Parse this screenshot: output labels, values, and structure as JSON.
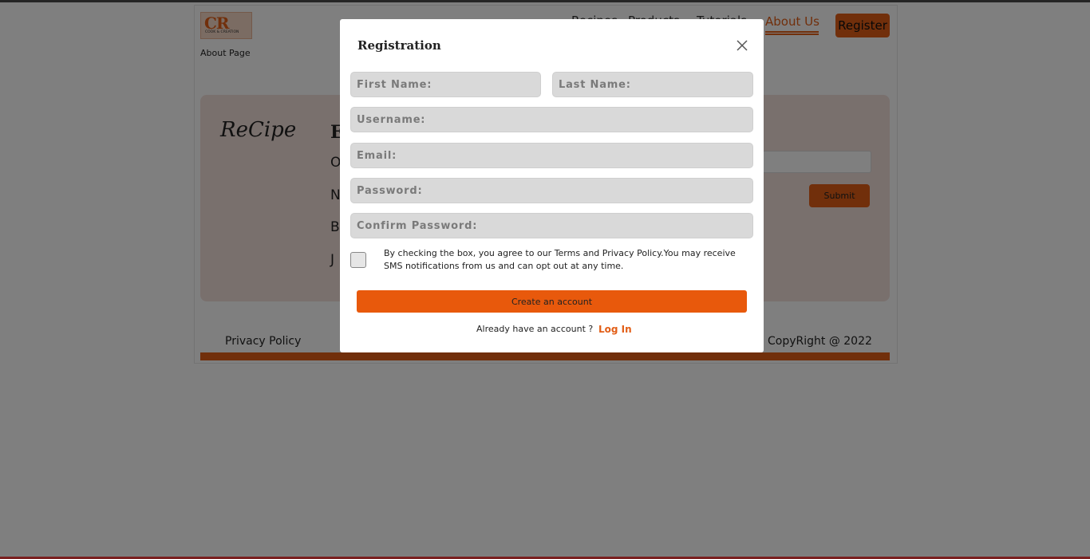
{
  "header": {
    "logo_text": "CR",
    "logo_subtext": "COOK & CREATION",
    "page_subtitle": "About Page",
    "nav": [
      "Recipes",
      "Products",
      "Tutorials",
      "About Us"
    ],
    "register_label": "Register"
  },
  "background_panel": {
    "brand_script": "ReCipe",
    "heading_fragment": "E",
    "line_fragments": [
      "O",
      "N",
      "B",
      "J"
    ],
    "submit_label": "Submit"
  },
  "footer": {
    "privacy_label": "Privacy Policy",
    "copyright_label": "CopyRight @ 2022"
  },
  "modal": {
    "title": "Registration",
    "first_name_placeholder": "First Name:",
    "last_name_placeholder": "Last Name:",
    "username_placeholder": "Username:",
    "email_placeholder": "Email:",
    "password_placeholder": "Password:",
    "confirm_password_placeholder": "Confirm Password:",
    "terms_text": "By checking the box, you agree to our Terms and Privacy Policy.You may receive SMS notifications from us and can opt out at any time.",
    "create_account_label": "Create an account",
    "already_text": "Already have an account ?",
    "login_label": "Log In"
  },
  "colors": {
    "accent": "#e8590c",
    "panel_bg": "#f3e0db",
    "overlay": "rgba(0,0,0,0.5)"
  },
  "icons": {
    "close": "close-icon"
  }
}
